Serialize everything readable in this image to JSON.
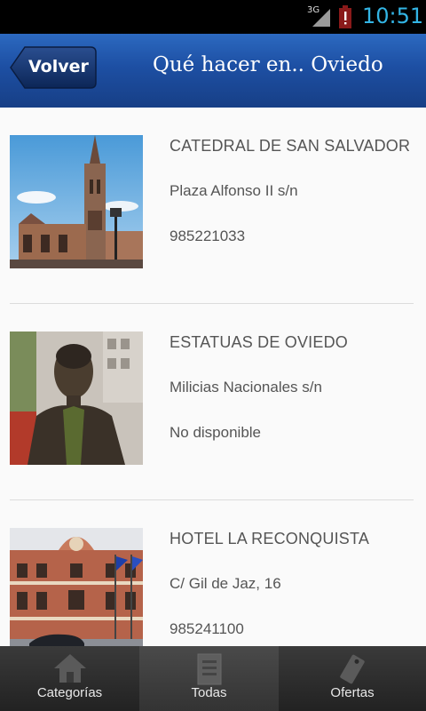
{
  "status_bar": {
    "network": "3G",
    "time": "10:51",
    "icons": [
      "signal-icon",
      "battery-alert-icon"
    ]
  },
  "header": {
    "back_label": "Volver",
    "title": "Qué hacer en.. Oviedo"
  },
  "items": [
    {
      "name": "CATEDRAL DE SAN SALVADOR",
      "address": "Plaza Alfonso II s/n",
      "phone": "985221033",
      "image": "cathedral-photo"
    },
    {
      "name": "ESTATUAS DE OVIEDO",
      "address": "Milicias Nacionales s/n",
      "phone": "No disponible",
      "image": "statue-photo"
    },
    {
      "name": "HOTEL LA RECONQUISTA",
      "address": "C/ Gil de Jaz, 16",
      "phone": "985241100",
      "image": "hotel-photo"
    }
  ],
  "tabs": [
    {
      "label": "Categorías",
      "icon": "home-icon",
      "active": false
    },
    {
      "label": "Todas",
      "icon": "list-icon",
      "active": true
    },
    {
      "label": "Ofertas",
      "icon": "tag-icon",
      "active": false
    }
  ],
  "colors": {
    "header_blue": "#1d4fa3",
    "clock_blue": "#33b5e5",
    "text_gray": "#555555"
  }
}
